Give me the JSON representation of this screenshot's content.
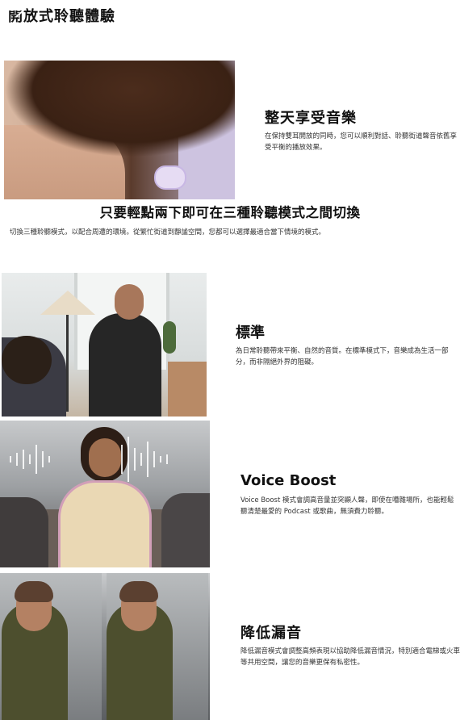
{
  "page": {
    "title": "開放式聆聽體驗"
  },
  "section_all_day": {
    "title": "整天享受音樂",
    "description": "在保持雙耳開放的同時，您可以順利對話、聆聽街道聲音依舊享受平衡的播放效果。"
  },
  "banner": {
    "title": "只要輕點兩下即可在三種聆聽模式之間切換",
    "description": "切換三種聆聽模式，以配合周遭的環境。從繁忙街道到靜謐空間，您都可以選擇最適合當下情境的模式。"
  },
  "mode_standard": {
    "title": "標準",
    "description": "為日常聆聽帶來平衡、自然的音質。在標準模式下，音樂成為生活一部分，而非隔絕外界的阻礙。"
  },
  "mode_voice_boost": {
    "title": "Voice Boost",
    "description": "Voice Boost 模式會調高音量並突顯人聲，即使在嘈雜場所，也能輕鬆聽清楚最愛的 Podcast 或歌曲，無須費力聆聽。"
  },
  "mode_leak_reduction": {
    "title": "降低漏音",
    "description": "降低漏音模式會調整高頻表現以協助降低漏音情況，特別適合電梯或火車等共用空間，讓您的音樂更保有私密性。"
  }
}
